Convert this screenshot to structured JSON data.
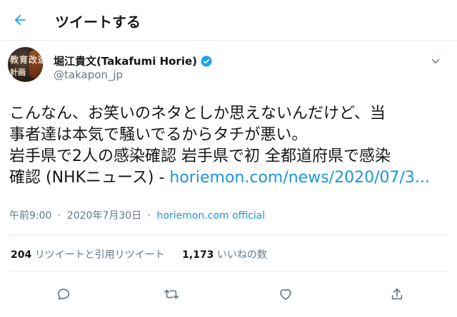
{
  "header": {
    "title": "ツイートする"
  },
  "author": {
    "display_name": "堀江貴文(Takafumi Horie)",
    "handle": "@takapon_jp",
    "avatar_text_line1": "教育改造",
    "avatar_text_line2": "計画"
  },
  "tweet": {
    "line1": "こんなん、お笑いのネタとしか思えないんだけど、当",
    "line2": "事者達は本気で騒いでるからタチが悪い。",
    "line3": "岩手県で2人の感染確認 岩手県で初 全都道府県で感染",
    "line4_prefix": "確認 (NHKニュース) - ",
    "link": "horiemon.com/news/2020/07/3..."
  },
  "meta": {
    "time": "午前9:00",
    "date": "2020年7月30日",
    "separator": "·",
    "source": "horiemon.com official"
  },
  "stats": {
    "retweets_count": "204",
    "retweets_label": "リツイートと引用リツイート",
    "likes_count": "1,173",
    "likes_label": "いいねの数"
  },
  "icons": {
    "back": "arrow-left-icon",
    "verified": "verified-badge-icon",
    "more": "chevron-down-icon",
    "reply": "reply-icon",
    "retweet": "retweet-icon",
    "like": "heart-icon",
    "share": "share-icon"
  },
  "colors": {
    "accent": "#1da1f2",
    "link": "#1b95e0",
    "muted": "#657786",
    "text": "#14171a",
    "divider": "#e6ecf0"
  }
}
